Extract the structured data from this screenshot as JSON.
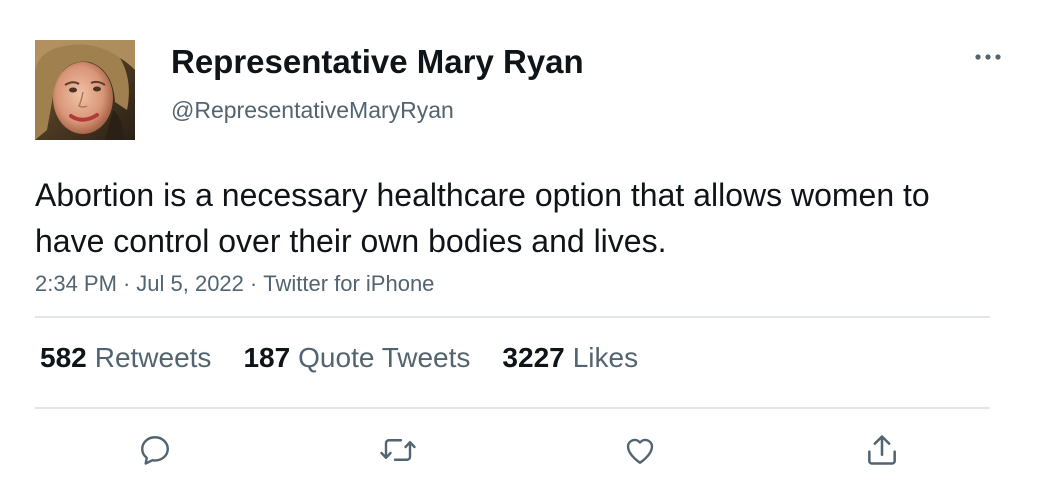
{
  "user": {
    "display_name": "Representative Mary Ryan",
    "handle": "@RepresentativeMaryRyan",
    "avatar": "avatar-photo"
  },
  "tweet": {
    "text": "Abortion is a necessary healthcare option that allows women to have control over their own bodies and lives.",
    "time": "2:34 PM",
    "date": "Jul 5, 2022",
    "source": "Twitter for iPhone",
    "separator": "·"
  },
  "stats": {
    "retweets": {
      "count": "582",
      "label": "Retweets"
    },
    "quote_tweets": {
      "count": "187",
      "label": "Quote Tweets"
    },
    "likes": {
      "count": "3227",
      "label": "Likes"
    }
  },
  "actions": {
    "reply": "reply-icon",
    "retweet": "retweet-icon",
    "like": "heart-icon",
    "share": "share-icon",
    "more": "more-icon"
  },
  "colors": {
    "text_primary": "#0f1419",
    "text_secondary": "#536471",
    "icon": "#536471",
    "divider": "#e3e6e8"
  }
}
